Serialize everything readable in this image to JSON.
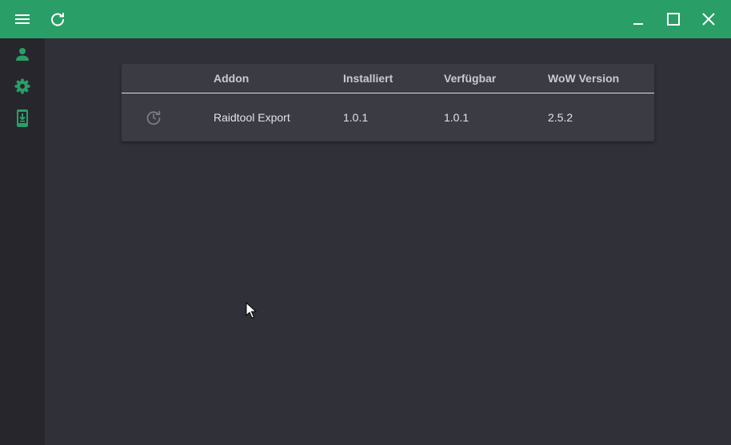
{
  "titlebar": {
    "menu_icon": "hamburger-menu-icon",
    "refresh_icon": "refresh-icon",
    "minimize_icon": "minimize-icon",
    "maximize_icon": "maximize-icon",
    "close_icon": "close-icon",
    "background": "#299f67"
  },
  "sidebar": {
    "items": [
      {
        "icon": "account-icon"
      },
      {
        "icon": "gear-icon"
      },
      {
        "icon": "phone-download-icon"
      }
    ],
    "accent": "#299f67"
  },
  "table": {
    "columns": [
      "",
      "Addon",
      "Installiert",
      "Verfügbar",
      "WoW Version"
    ],
    "rows": [
      {
        "action_icon": "update-icon",
        "addon": "Raidtool Export",
        "installed": "1.0.1",
        "available": "1.0.1",
        "wow_version": "2.5.2"
      }
    ]
  }
}
